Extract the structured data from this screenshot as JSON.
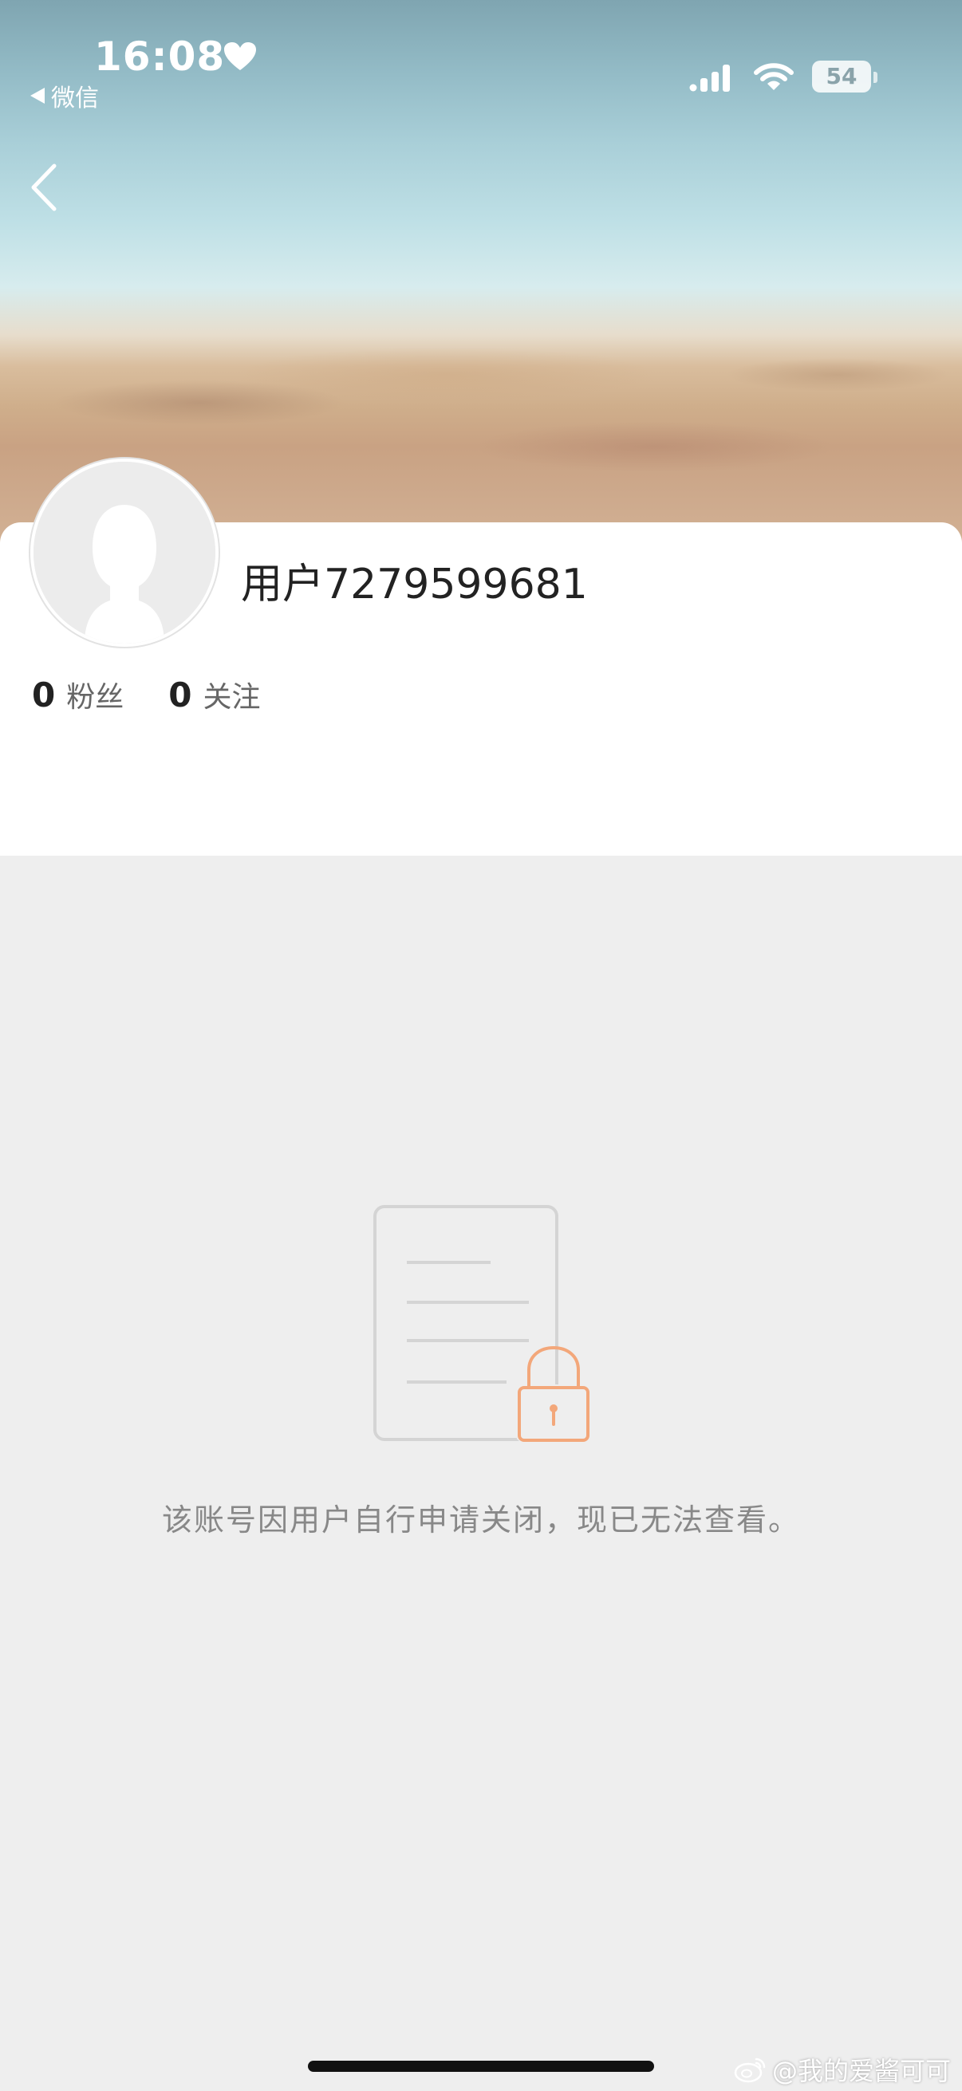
{
  "status_bar": {
    "time": "16:08",
    "back_app_label": "微信",
    "battery": "54"
  },
  "profile": {
    "username": "用户7279599681",
    "followers_count": "0",
    "followers_label": "粉丝",
    "following_count": "0",
    "following_label": "关注"
  },
  "notice": {
    "text": "该账号因用户自行申请关闭，现已无法查看。"
  },
  "watermark": {
    "text": "@我的爱酱可可"
  },
  "colors": {
    "lock_accent": "#f3a77a",
    "page_background": "#eeeeee"
  }
}
